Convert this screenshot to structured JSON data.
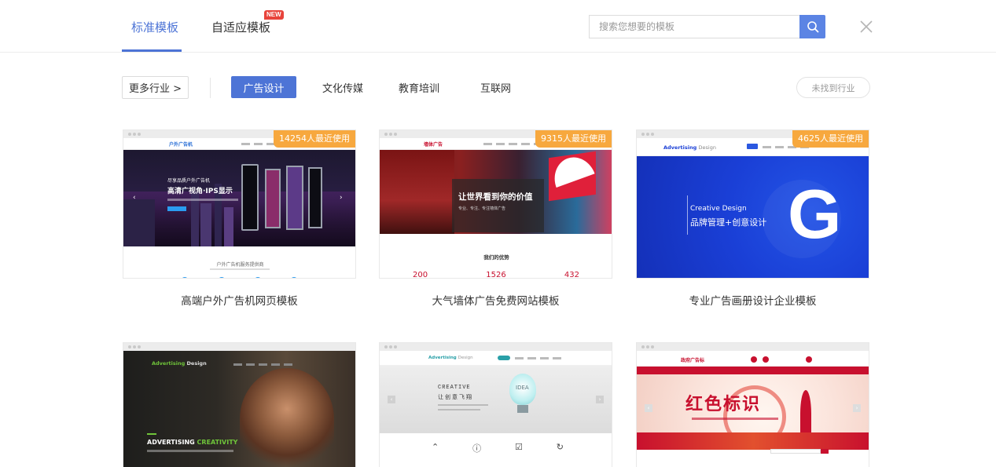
{
  "header": {
    "tab_standard": "标准模板",
    "tab_adaptive": "自适应模板",
    "new_badge": "NEW",
    "search_placeholder": "搜索您想要的模板"
  },
  "filters": {
    "more_label": "更多行业 >",
    "categories": [
      "广告设计",
      "文化传媒",
      "教育培训",
      "互联网"
    ],
    "active_category": "广告设计",
    "not_found_label": "未找到行业"
  },
  "templates": [
    {
      "title": "高端户外广告机网页模板",
      "usage": "14254人最近使用",
      "preview": {
        "logo": "户外广告机",
        "hero_sub": "尽享品质户外广告机",
        "hero_title": "高清广视角·IPS显示",
        "section_title": "户外广告机服务提供商"
      }
    },
    {
      "title": "大气墙体广告免费网站模板",
      "usage": "9315人最近使用",
      "preview": {
        "logo": "墙体广告",
        "hero_title": "让世界看到你的价值",
        "hero_sub": "专业、专注、专注墙体广告",
        "section_title": "我们的优势",
        "stats": [
          "200",
          "1526",
          "432"
        ]
      }
    },
    {
      "title": "专业广告画册设计企业模板",
      "usage": "4625人最近使用",
      "preview": {
        "logo_main": "Advertising",
        "logo_sub": "Design",
        "hero_en": "Creative Design",
        "hero_cn": "品牌管理+创意设计",
        "big_letter": "G"
      }
    },
    {
      "title": "",
      "preview": {
        "logo_main": "Advertising",
        "logo_sub": "Design",
        "hero_a": "ADVERTISING",
        "hero_b": "CREATIVITY"
      }
    },
    {
      "title": "",
      "preview": {
        "logo_main": "Advertising",
        "logo_sub": "Design",
        "hero_en": "CREATIVE",
        "hero_cn": "让创意飞翔",
        "bulb_text": "IDEA"
      }
    },
    {
      "title": "",
      "preview": {
        "logo": "政府广告标",
        "hero_title": "红色标识"
      }
    }
  ],
  "colors": {
    "accent": "#4d74d6",
    "badge": "#f7a83e",
    "new_badge": "#e8433b"
  }
}
